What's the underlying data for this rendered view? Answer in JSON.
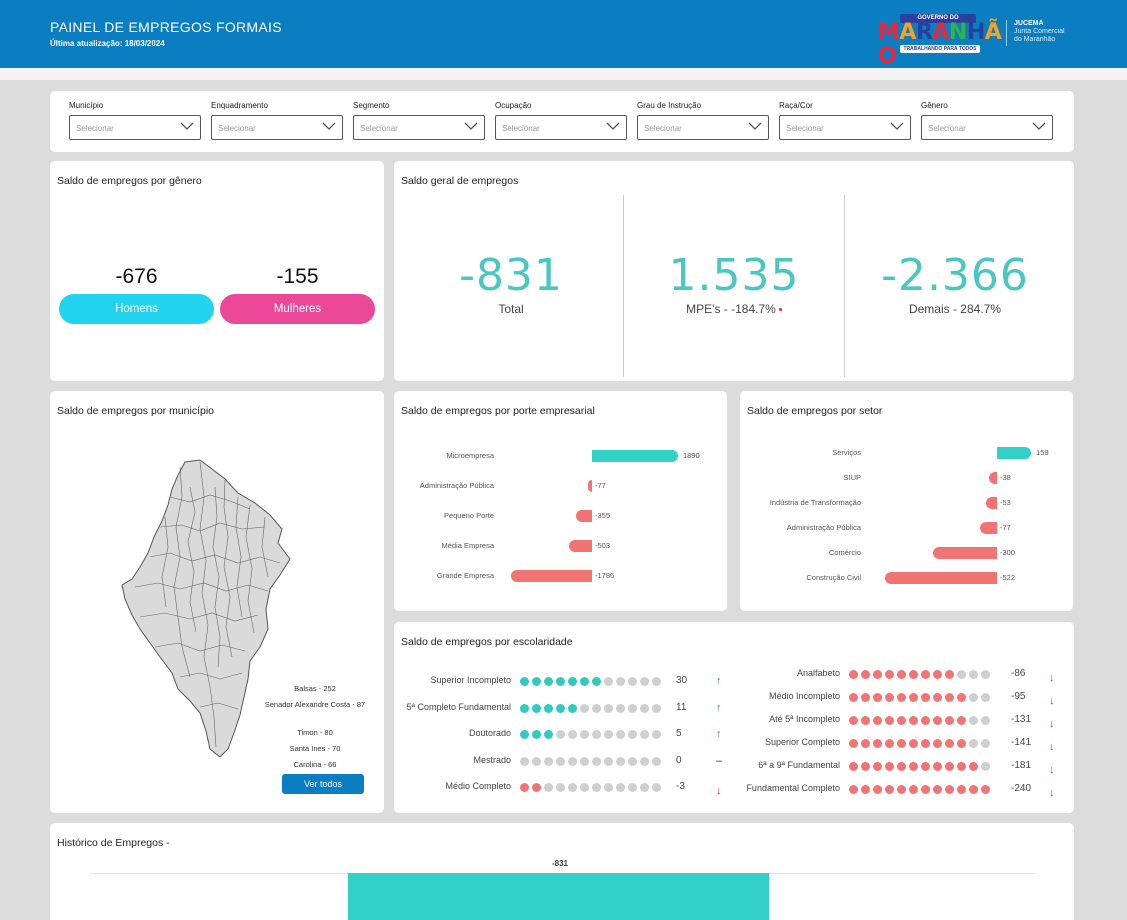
{
  "header": {
    "title": "PAINEL DE EMPREGOS FORMAIS",
    "updated": "Última atualização: 18/03/2024",
    "logo_top": "GOVERNO DO",
    "logo_main": "MARANHÃO",
    "logo_bottom": "TRABALHANDO PARA TODOS",
    "org_name": "JUCEMA",
    "org_sub1": "Junta Comercial",
    "org_sub2": "do Maranhão"
  },
  "filters": [
    {
      "label": "Município",
      "placeholder": "Selecionar"
    },
    {
      "label": "Enquadramento",
      "placeholder": "Selecionar"
    },
    {
      "label": "Segmento",
      "placeholder": "Selecionar"
    },
    {
      "label": "Ocupação",
      "placeholder": "Selecionar"
    },
    {
      "label": "Grau de Instrução",
      "placeholder": "Selecionar"
    },
    {
      "label": "Raça/Cor",
      "placeholder": "Selecionar"
    },
    {
      "label": "Gênero",
      "placeholder": "Selecionar"
    }
  ],
  "gender": {
    "title": "Saldo de empregos por gênero",
    "men_value": "-676",
    "women_value": "-155",
    "men_label": "Homens",
    "women_label": "Mulheres",
    "men_color": "#22d3ee",
    "women_color": "#ec4899"
  },
  "general": {
    "title": "Saldo geral de empregos",
    "total_value": "-831",
    "total_label": "Total",
    "mpe_value": "1.535",
    "mpe_label": "MPE's - -184.7%",
    "other_value": "-2.366",
    "other_label": "Demais - 284.7%"
  },
  "municipality": {
    "title": "Saldo de empregos por município",
    "cities": [
      "Balsas - 252",
      "Senador Alexandre Costa - 87",
      "Timon - 80",
      "Santa Ines - 70",
      "Carolina - 66"
    ],
    "see_all": "Ver todos"
  },
  "company_size": {
    "title": "Saldo de empregos por porte empresarial",
    "items": [
      {
        "label": "Microempresa",
        "value": 1890,
        "text": "1890"
      },
      {
        "label": "Administração Pública",
        "value": -77,
        "text": "-77"
      },
      {
        "label": "Pequeno Porte",
        "value": -355,
        "text": "-355"
      },
      {
        "label": "Média Empresa",
        "value": -503,
        "text": "-503"
      },
      {
        "label": "Grande Empresa",
        "value": -1786,
        "text": "-1786"
      }
    ]
  },
  "sector": {
    "title": "Saldo de empregos por setor",
    "items": [
      {
        "label": "Serviços",
        "value": 159,
        "text": "159"
      },
      {
        "label": "SIUP",
        "value": -38,
        "text": "-38"
      },
      {
        "label": "Indústria de Transformação",
        "value": -53,
        "text": "-53"
      },
      {
        "label": "Administração Pública",
        "value": -77,
        "text": "-77"
      },
      {
        "label": "Comércio",
        "value": -300,
        "text": "-300"
      },
      {
        "label": "Construção Civil",
        "value": -522,
        "text": "-522"
      }
    ]
  },
  "education": {
    "title": "Saldo de empregos por escolaridade",
    "left": [
      {
        "label": "Superior Incompleto",
        "value": "30",
        "filled": 7,
        "color": "#33c9bf",
        "trend": "up"
      },
      {
        "label": "5ª Completo Fundamental",
        "value": "11",
        "filled": 5,
        "color": "#33c9bf",
        "trend": "up"
      },
      {
        "label": "Doutorado",
        "value": "5",
        "filled": 3,
        "color": "#33c9bf",
        "trend": "up"
      },
      {
        "label": "Mestrado",
        "value": "0",
        "filled": 0,
        "color": "#33c9bf",
        "trend": "flat"
      },
      {
        "label": "Médio Completo",
        "value": "-3",
        "filled": 2,
        "color": "#f17474",
        "trend": "down"
      }
    ],
    "right": [
      {
        "label": "Analfabeto",
        "value": "-86",
        "filled": 9,
        "color": "#f17474",
        "trend": "down"
      },
      {
        "label": "Médio Incompleto",
        "value": "-95",
        "filled": 10,
        "color": "#f17474",
        "trend": "down"
      },
      {
        "label": "Até 5ª Incompleto",
        "value": "-131",
        "filled": 10,
        "color": "#f17474",
        "trend": "down"
      },
      {
        "label": "Superior Completo",
        "value": "-141",
        "filled": 10,
        "color": "#f17474",
        "trend": "down"
      },
      {
        "label": "6ª a 9ª Fundamental",
        "value": "-181",
        "filled": 11,
        "color": "#f17474",
        "trend": "down"
      },
      {
        "label": "Fundamental Completo",
        "value": "-240",
        "filled": 12,
        "color": "#f17474",
        "trend": "down"
      }
    ],
    "arrows": {
      "up": "↑",
      "down": "↓",
      "flat": "–"
    }
  },
  "history": {
    "title": "Histórico de Empregos -",
    "bar_label": "-831",
    "bar_value": -831,
    "bar_color": "#33d0c8"
  },
  "colors": {
    "header": "#0b7dc1",
    "positive": "#33d0c8",
    "negative": "#f17474",
    "kpi": "#4ac7c0"
  }
}
